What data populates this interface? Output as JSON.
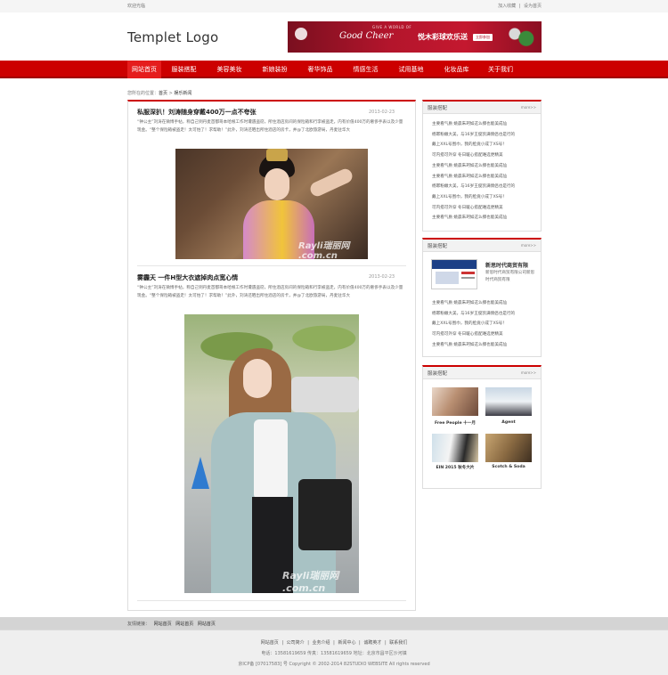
{
  "topbar": {
    "welcome": "欢迎光临",
    "links": [
      "加入收藏",
      "|",
      "设为首页"
    ]
  },
  "header": {
    "logo": "Templet Logo",
    "banner": {
      "small_text": "GIVE A WORLD OF",
      "script_text": "Good Cheer",
      "headline": "悦木彩球欢乐送",
      "button": "立即参加"
    }
  },
  "nav": {
    "items": [
      "网站首页",
      "服装搭配",
      "美容美妆",
      "新娘装扮",
      "奢华饰品",
      "情感生活",
      "试用基地",
      "化妆品库",
      "关于我们"
    ],
    "active_index": 0
  },
  "breadcrumb": {
    "prefix": "您所在的位置：",
    "home": "首页",
    "sep": " > ",
    "current": "娱乐新闻"
  },
  "articles": [
    {
      "title": "私服深扒！刘涛随身穿戴400万一点不夸张",
      "date": "2013-02-23",
      "body": "“钟公主”刘涛在微博手帖，称自己到丹麦首都哥本哈根工作时遭遇盗窃，所住酒店房间的保险箱和行李被盗走，内有价值400万的奢侈手表以及少量现金。“整个保险箱被盗走！太可怕了！求帮助！”此外，刘涛还晒出所住酒店的房卡，并@了北欧旅游局，丹麦驻华大",
      "watermark": "Rayli瑞丽网 .com.cn"
    },
    {
      "title": "雾霾天 一件H型大衣遮掉肉点宽心情",
      "date": "2013-02-23",
      "body": "“钟公主”刘涛在微博手帖，称自己到丹麦首都哥本哈根工作时遭遇盗窃，所住酒店房间的保险箱和行李被盗走，内有价值400万的奢侈手表以及少量现金。“整个保险箱被盗走！太可怕了！求帮助！”此外，刘涛还晒出所住酒店的房卡，并@了北欧旅游局，丹麦驻华大",
      "watermark": "Rayli瑞丽网 .com.cn"
    }
  ],
  "sidebar": {
    "box1": {
      "title": "服装搭配",
      "more": "more>>",
      "items": [
        "主要看气质 姚晨朱珂如这么撑也能美成仙",
        "杨幂粉嫩大美，与16岁王俊凯满情侣也是行的",
        "戴上XXL号围巾，我的脸竟小成了XS号！",
        "可内搭可外穿 冬日暖心搭配难选更精美",
        "主要看气质 姚晨朱珂如这么撑也能美成仙",
        "主要看气质 姚晨朱珂如这么撑也能美成仙",
        "杨幂粉嫩大美，与16岁王俊凯满情侣也是行的",
        "戴上XXL号围巾，我的脸竟小成了XS号！",
        "可内搭可外穿 冬日暖心搭配难选更精美",
        "主要看气质 姚晨朱珂如这么撑也能美成仙"
      ]
    },
    "box2": {
      "title": "服装搭配",
      "more": "more>>",
      "feature": {
        "title": "新思时代商贸有限",
        "desc": "新思时代商贸有限公司新思时代商贸有限"
      },
      "items": [
        "主要看气质 姚晨朱珂如这么撑也能美成仙",
        "杨幂粉嫩大美，与16岁王俊凯满情侣也是行的",
        "戴上XXL号围巾，我的脸竟小成了XS号！",
        "可内搭可外穿 冬日暖心搭配难选更精美",
        "主要看气质 姚晨朱珂如这么撑也能美成仙"
      ]
    },
    "box3": {
      "title": "服装搭配",
      "more": "more>>",
      "thumbs": [
        {
          "caption": "Free People 十一月"
        },
        {
          "caption": "Agent"
        },
        {
          "caption": "EIN 2015 秋冬大片"
        },
        {
          "caption": "Scotch & Soda"
        }
      ]
    }
  },
  "links": {
    "label": "友情链接：",
    "items": [
      "网站首页",
      "网站首页",
      "网站首页"
    ]
  },
  "footer": {
    "nav": [
      "网站首页",
      "|",
      "公司简介",
      "|",
      "业务介绍",
      "|",
      "新闻中心",
      "|",
      "诚聘英才",
      "|",
      "联系我们"
    ],
    "info": "电话：13581619659 传真：13581619659 地址：北京市昌平区沙河镇",
    "copyright": "京ICP备 [07017583] 号 Copyright © 2002-2014 82STUDIO WEBSITE All rights reserved"
  },
  "colors": {
    "accent": "#cc0000",
    "nav_active": "#e51d1d"
  }
}
